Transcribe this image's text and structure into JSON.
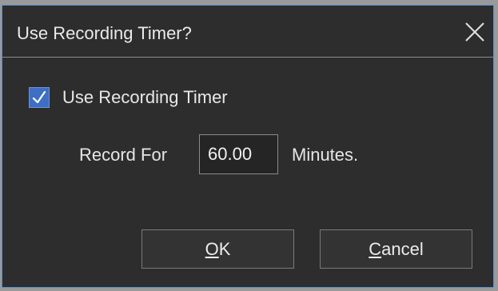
{
  "dialog": {
    "title": "Use Recording Timer?",
    "close_icon": "close-icon"
  },
  "timer": {
    "checkbox_label": "Use Recording Timer",
    "checked": true,
    "record_for_label": "Record For",
    "minutes_value": "60.00",
    "minutes_unit_label": "Minutes."
  },
  "buttons": {
    "ok": {
      "mnemonic": "O",
      "rest": "K"
    },
    "cancel": {
      "mnemonic": "C",
      "rest": "ancel"
    }
  },
  "colors": {
    "dialog_background": "#2d2d2d",
    "accent": "#3d6fc4",
    "border_highlight": "#5a8fc8"
  }
}
